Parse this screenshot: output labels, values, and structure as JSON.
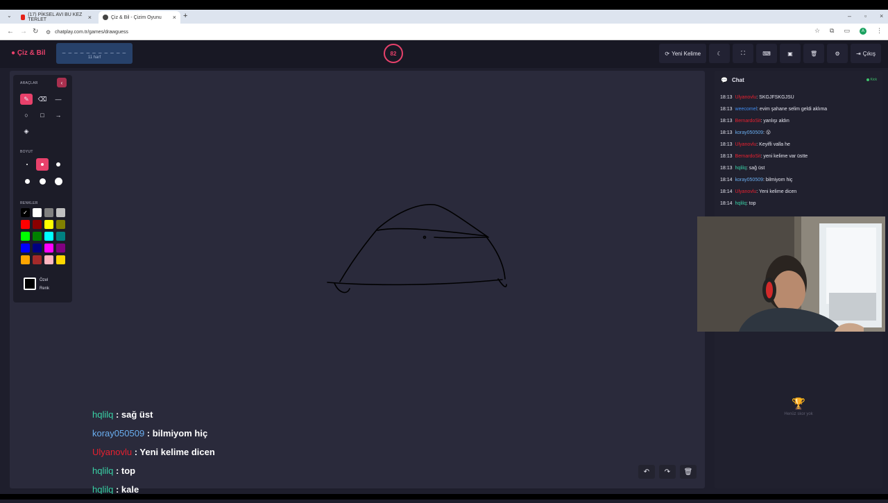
{
  "browser": {
    "tabs": [
      {
        "title": "(17) PİKSEL AVI BU KEZ TERLET",
        "favicon_color": "#e62117"
      },
      {
        "title": "Çiz & Bil - Çizim Oyunu",
        "favicon_color": "#444444"
      }
    ],
    "url": "chatplay.com.tr/games/drawguess",
    "profile_initial": "A"
  },
  "header": {
    "logo": "Çiz & Bil",
    "word_hint": "_ _ _ _ _ _ _ _ _ _ _",
    "word_count": "11 harf",
    "timer": "82",
    "new_word_label": "Yeni Kelime",
    "exit_label": "Çıkış"
  },
  "tools": {
    "tools_label": "ARAÇLAR",
    "size_label": "BOYUT",
    "colors_label": "RENKLER",
    "custom_color_label_1": "Özel",
    "custom_color_label_2": "Renk",
    "swatches": [
      "#000000",
      "#ffffff",
      "#808080",
      "#c0c0c0",
      "#ff0000",
      "#8b0000",
      "#ffff00",
      "#808000",
      "#00ff00",
      "#008000",
      "#00ffff",
      "#008080",
      "#0000ff",
      "#000080",
      "#ff00ff",
      "#800080",
      "#ffa500",
      "#a52a2a",
      "#ffb6c1",
      "#ffd700"
    ]
  },
  "overlay_chat": [
    {
      "user": "hqlilq",
      "color": "#39d2a6",
      "text": " : sağ üst"
    },
    {
      "user": "koray050509",
      "color": "#6aaef0",
      "text": " : bilmiyom hiç"
    },
    {
      "user": "Ulyanovlu",
      "color": "#e8202f",
      "text": " : Yeni kelime dicen"
    },
    {
      "user": "hqlilq",
      "color": "#39d2a6",
      "text": " : top"
    },
    {
      "user": "hqlilq",
      "color": "#39d2a6",
      "text": " : kale"
    }
  ],
  "chat": {
    "title": "Chat",
    "kick_label": "Kick",
    "messages": [
      {
        "time": "18:13",
        "user": "Ulyanovlu",
        "color": "#e8202f",
        "text": ": SKGJFSKGJSÜ"
      },
      {
        "time": "18:13",
        "user": "weecomel",
        "color": "#3f8cf0",
        "text": ": evim şahane selim geldi aklıma"
      },
      {
        "time": "18:13",
        "user": "BernardoSit",
        "color": "#e8202f",
        "text": ": yanlışı aldın"
      },
      {
        "time": "18:13",
        "user": "koray050509",
        "color": "#6aaef0",
        "text": ": 😮"
      },
      {
        "time": "18:13",
        "user": "Ulyanovlu",
        "color": "#e8202f",
        "text": ": Keyifli valla he"
      },
      {
        "time": "18:13",
        "user": "BernardoSit",
        "color": "#e8202f",
        "text": ": yeni kelime var üstte"
      },
      {
        "time": "18:13",
        "user": "hqlilq",
        "color": "#39d2a6",
        "text": ": sağ üst"
      },
      {
        "time": "18:14",
        "user": "koray050509",
        "color": "#6aaef0",
        "text": ": bilmiyom hiç"
      },
      {
        "time": "18:14",
        "user": "Ulyanovlu",
        "color": "#e8202f",
        "text": ": Yeni kelime dicen"
      },
      {
        "time": "18:14",
        "user": "hqlilq",
        "color": "#39d2a6",
        "text": ": top"
      }
    ]
  },
  "scoreboard": {
    "empty_text": "Henüz skor yok"
  },
  "colors": {
    "accent": "#e8416b",
    "online": "#3ec46d"
  }
}
